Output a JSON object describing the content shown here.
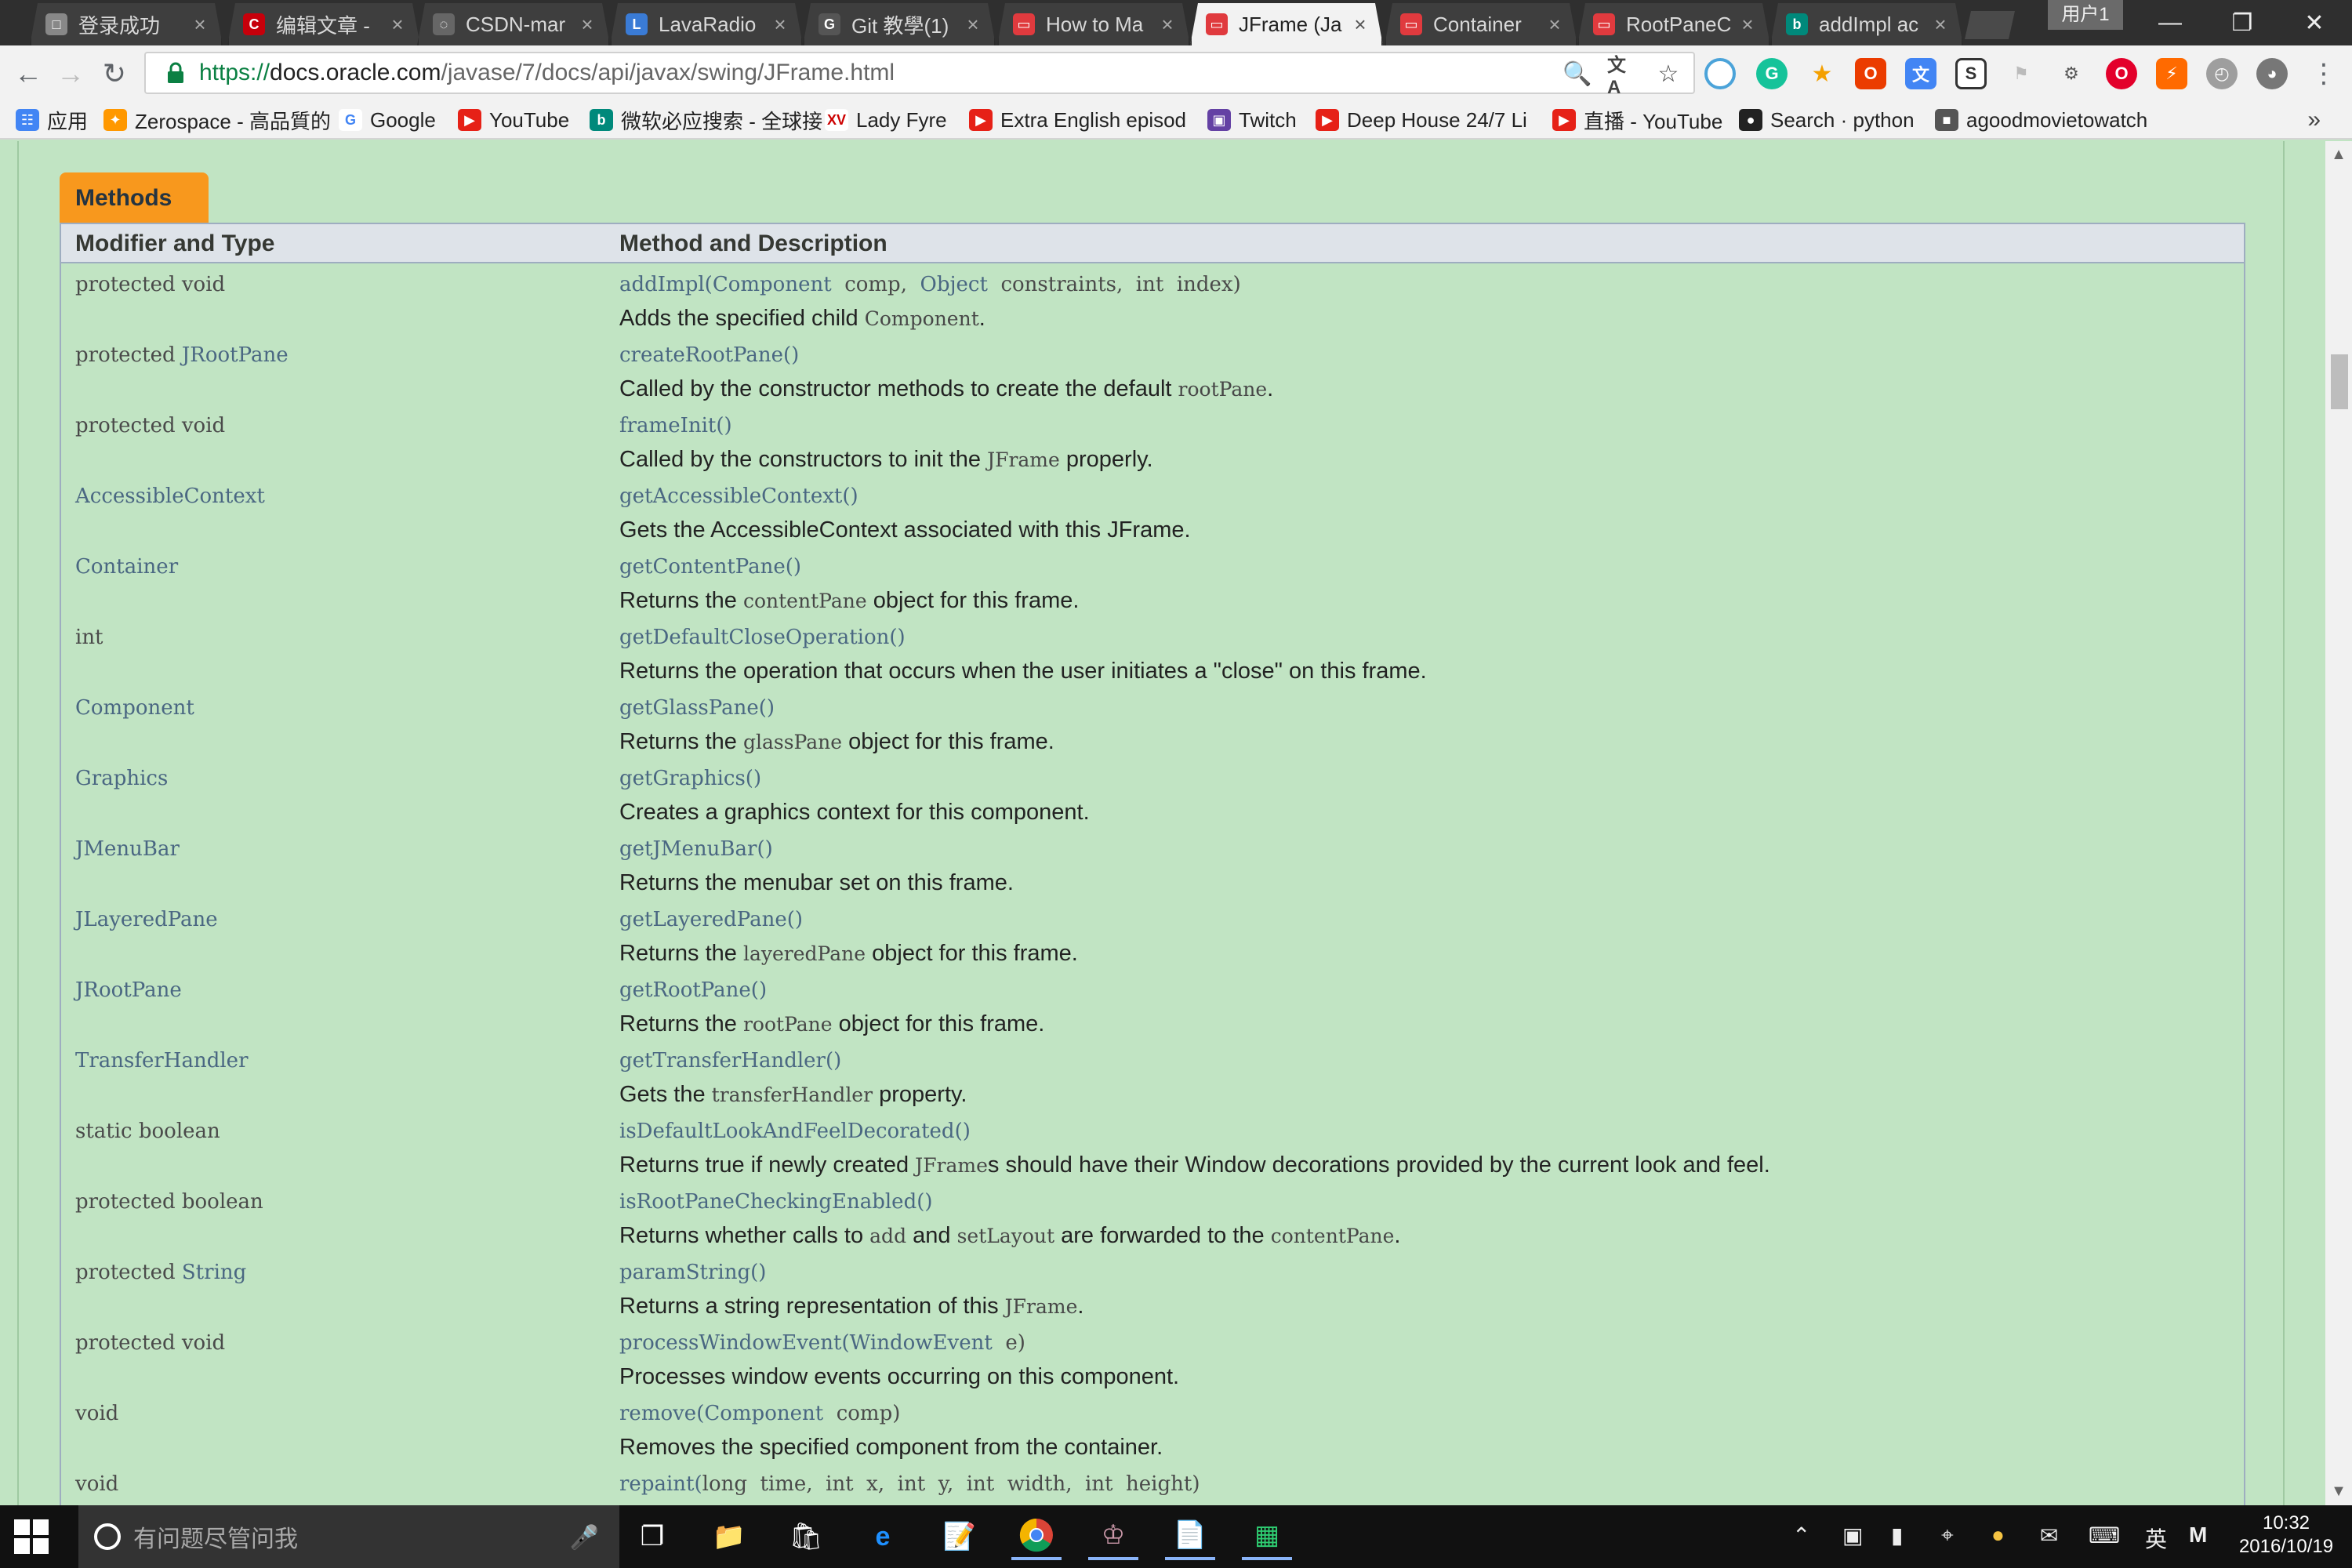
{
  "browser": {
    "tabs": [
      {
        "label": "登录成功",
        "icon": "doc-icon",
        "active": false
      },
      {
        "label": "编辑文章 - ",
        "icon": "csdn-icon",
        "active": false
      },
      {
        "label": "CSDN-mar",
        "icon": "loading-icon",
        "active": false
      },
      {
        "label": "LavaRadio",
        "icon": "lavaradio-icon",
        "active": false
      },
      {
        "label": "Git 教學(1)",
        "icon": "git-icon",
        "active": false
      },
      {
        "label": "How to Ma",
        "icon": "oracle-icon",
        "active": false
      },
      {
        "label": "JFrame (Ja",
        "icon": "oracle-icon",
        "active": true
      },
      {
        "label": "Container",
        "icon": "oracle-icon",
        "active": false
      },
      {
        "label": "RootPaneC",
        "icon": "oracle-icon",
        "active": false
      },
      {
        "label": "addImpl ac",
        "icon": "bing-icon",
        "active": false
      }
    ],
    "user_label": "用户1",
    "url": {
      "protocol": "https://",
      "host": "docs.oracle.com",
      "path": "/javase/7/docs/api/javax/swing/JFrame.html"
    },
    "bookmarks": [
      {
        "label": "应用",
        "icon": "apps-grid-icon"
      },
      {
        "label": "Zerospace - 高品質的",
        "icon": "zerospace-icon"
      },
      {
        "label": "Google",
        "icon": "google-icon"
      },
      {
        "label": "YouTube",
        "icon": "youtube-icon"
      },
      {
        "label": "微软必应搜索 - 全球接",
        "icon": "bing-icon"
      },
      {
        "label": "Lady Fyre",
        "icon": "xv-icon"
      },
      {
        "label": "Extra English episod",
        "icon": "youtube-icon"
      },
      {
        "label": "Twitch",
        "icon": "twitch-icon"
      },
      {
        "label": "Deep House 24/7 Li",
        "icon": "youtube-icon"
      },
      {
        "label": "直播 - YouTube",
        "icon": "youtube-icon"
      },
      {
        "label": "Search · python",
        "icon": "github-icon"
      },
      {
        "label": "agoodmovietowatch",
        "icon": "movie-icon"
      }
    ]
  },
  "page": {
    "caption": "Methods",
    "headers": {
      "modifier": "Modifier and Type",
      "method": "Method and Description"
    },
    "methods": [
      {
        "mod_prefix": "protected void",
        "mod_link": "",
        "name": "addImpl",
        "params": [
          {
            "type": "Component",
            "name": "comp",
            "sep": ",  "
          },
          {
            "type": "Object",
            "name": "constraints",
            "sep": ",  "
          },
          {
            "type": "int",
            "plain": true,
            "name": "index",
            "sep": ""
          }
        ],
        "desc": [
          {
            "t": "Adds the specified child "
          },
          {
            "c": "Component"
          },
          {
            "t": "."
          }
        ]
      },
      {
        "mod_prefix": "protected ",
        "mod_link": "JRootPane",
        "name": "createRootPane",
        "params": [],
        "desc": [
          {
            "t": "Called by the constructor methods to create the default "
          },
          {
            "c": "rootPane"
          },
          {
            "t": "."
          }
        ]
      },
      {
        "mod_prefix": "protected void",
        "mod_link": "",
        "name": "frameInit",
        "params": [],
        "desc": [
          {
            "t": "Called by the constructors to init the "
          },
          {
            "c": "JFrame"
          },
          {
            "t": " properly."
          }
        ]
      },
      {
        "mod_prefix": "",
        "mod_link": "AccessibleContext",
        "name": "getAccessibleContext",
        "params": [],
        "desc": [
          {
            "t": "Gets the AccessibleContext associated with this JFrame."
          }
        ]
      },
      {
        "mod_prefix": "",
        "mod_link": "Container",
        "name": "getContentPane",
        "params": [],
        "desc": [
          {
            "t": "Returns the "
          },
          {
            "c": "contentPane"
          },
          {
            "t": " object for this frame."
          }
        ]
      },
      {
        "mod_prefix": "int",
        "mod_link": "",
        "name": "getDefaultCloseOperation",
        "params": [],
        "desc": [
          {
            "t": "Returns the operation that occurs when the user initiates a \"close\" on this frame."
          }
        ]
      },
      {
        "mod_prefix": "",
        "mod_link": "Component",
        "name": "getGlassPane",
        "params": [],
        "desc": [
          {
            "t": "Returns the "
          },
          {
            "c": "glassPane"
          },
          {
            "t": " object for this frame."
          }
        ]
      },
      {
        "mod_prefix": "",
        "mod_link": "Graphics",
        "name": "getGraphics",
        "params": [],
        "desc": [
          {
            "t": "Creates a graphics context for this component."
          }
        ]
      },
      {
        "mod_prefix": "",
        "mod_link": "JMenuBar",
        "name": "getJMenuBar",
        "params": [],
        "desc": [
          {
            "t": "Returns the menubar set on this frame."
          }
        ]
      },
      {
        "mod_prefix": "",
        "mod_link": "JLayeredPane",
        "name": "getLayeredPane",
        "params": [],
        "desc": [
          {
            "t": "Returns the "
          },
          {
            "c": "layeredPane"
          },
          {
            "t": " object for this frame."
          }
        ]
      },
      {
        "mod_prefix": "",
        "mod_link": "JRootPane",
        "name": "getRootPane",
        "params": [],
        "desc": [
          {
            "t": "Returns the "
          },
          {
            "c": "rootPane"
          },
          {
            "t": " object for this frame."
          }
        ]
      },
      {
        "mod_prefix": "",
        "mod_link": "TransferHandler",
        "name": "getTransferHandler",
        "params": [],
        "desc": [
          {
            "t": "Gets the "
          },
          {
            "c": "transferHandler"
          },
          {
            "t": " property."
          }
        ]
      },
      {
        "mod_prefix": "static boolean",
        "mod_link": "",
        "name": "isDefaultLookAndFeelDecorated",
        "params": [],
        "desc": [
          {
            "t": "Returns true if newly created "
          },
          {
            "c": "JFrame"
          },
          {
            "t": "s should have their Window decorations provided by the current look and feel."
          }
        ]
      },
      {
        "mod_prefix": "protected boolean",
        "mod_link": "",
        "name": "isRootPaneCheckingEnabled",
        "params": [],
        "desc": [
          {
            "t": "Returns whether calls to "
          },
          {
            "c": "add"
          },
          {
            "t": " and "
          },
          {
            "c": "setLayout"
          },
          {
            "t": " are forwarded to the "
          },
          {
            "c": "contentPane"
          },
          {
            "t": "."
          }
        ]
      },
      {
        "mod_prefix": "protected ",
        "mod_link": "String",
        "name": "paramString",
        "params": [],
        "desc": [
          {
            "t": "Returns a string representation of this "
          },
          {
            "c": "JFrame"
          },
          {
            "t": "."
          }
        ]
      },
      {
        "mod_prefix": "protected void",
        "mod_link": "",
        "name": "processWindowEvent",
        "params": [
          {
            "type": "WindowEvent",
            "name": "e",
            "sep": ""
          }
        ],
        "desc": [
          {
            "t": "Processes window events occurring on this component."
          }
        ]
      },
      {
        "mod_prefix": "void",
        "mod_link": "",
        "name": "remove",
        "params": [
          {
            "type": "Component",
            "name": "comp",
            "sep": ""
          }
        ],
        "desc": [
          {
            "t": "Removes the specified component from the container."
          }
        ]
      },
      {
        "mod_prefix": "void",
        "mod_link": "",
        "name": "repaint",
        "params": [
          {
            "type": "long",
            "plain": true,
            "name": "time",
            "sep": ",  "
          },
          {
            "type": "int",
            "plain": true,
            "name": "x",
            "sep": ",  "
          },
          {
            "type": "int",
            "plain": true,
            "name": "y",
            "sep": ",  "
          },
          {
            "type": "int",
            "plain": true,
            "name": "width",
            "sep": ",  "
          },
          {
            "type": "int",
            "plain": true,
            "name": "height",
            "sep": ""
          }
        ],
        "desc": []
      }
    ]
  },
  "taskbar": {
    "search_placeholder": "有问题尽管问我",
    "ime_label": "英",
    "time": "10:32",
    "date": "2016/10/19"
  },
  "colors": {
    "page_bg": "#c1e4c3",
    "caption_bg": "#f8981d",
    "header_bg": "#dee3e9",
    "link": "#4a6782",
    "secure_green": "#0b8043"
  }
}
